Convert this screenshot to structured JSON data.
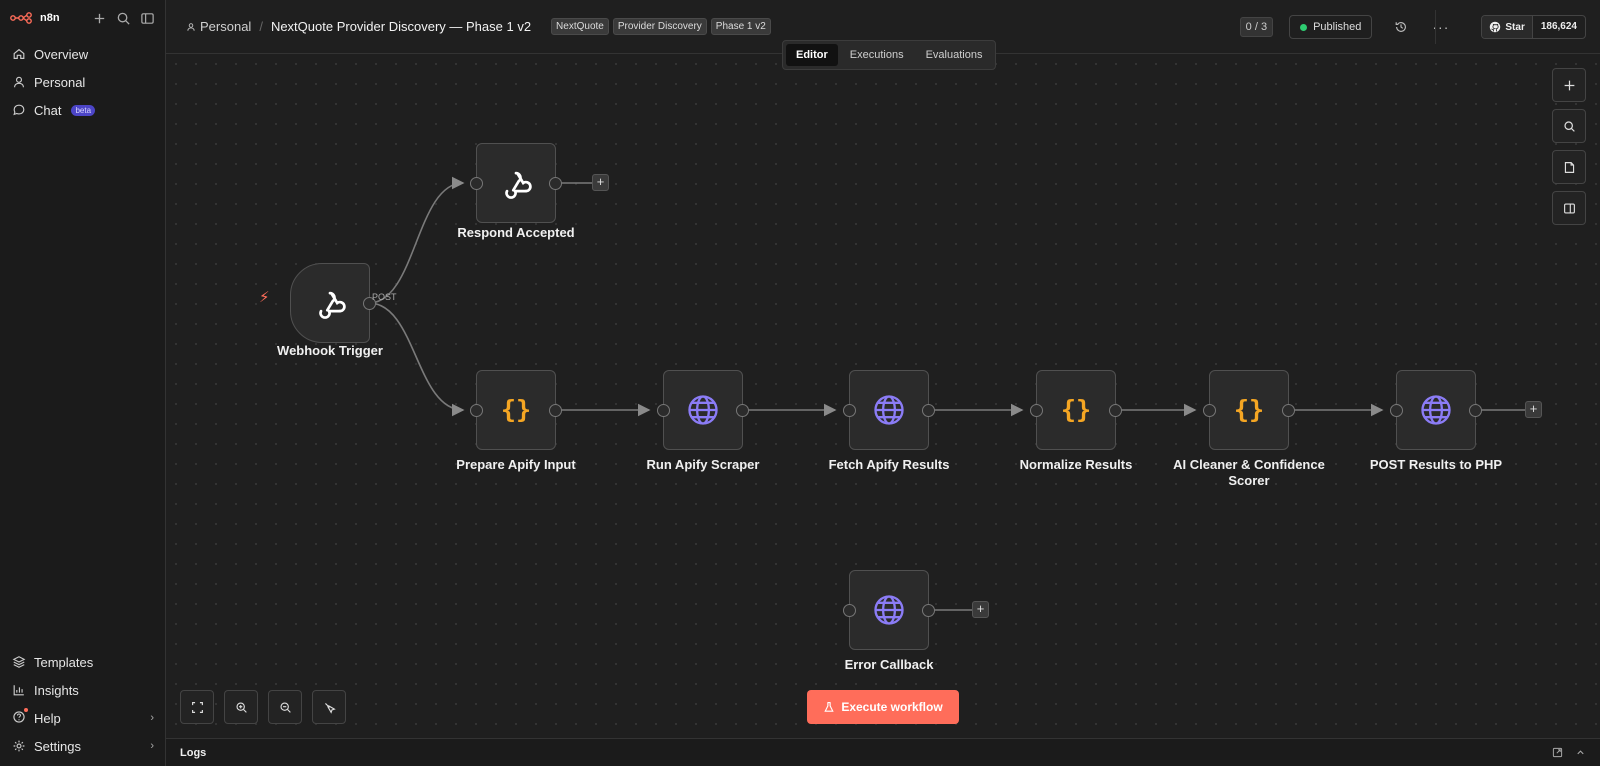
{
  "app": {
    "logo_text": "n8n"
  },
  "sidebar": {
    "items": [
      {
        "label": "Overview",
        "icon": "home-icon"
      },
      {
        "label": "Personal",
        "icon": "user-icon"
      },
      {
        "label": "Chat",
        "icon": "chat-icon",
        "badge": "beta"
      }
    ],
    "bottom_items": [
      {
        "label": "Templates",
        "icon": "templates-icon"
      },
      {
        "label": "Insights",
        "icon": "insights-icon"
      },
      {
        "label": "Help",
        "icon": "help-icon"
      },
      {
        "label": "Settings",
        "icon": "settings-icon"
      }
    ]
  },
  "header": {
    "breadcrumb_project": "Personal",
    "breadcrumb_sep": "/",
    "workflow_title": "NextQuote Provider Discovery — Phase 1 v2",
    "tags": [
      "NextQuote",
      "Provider Discovery",
      "Phase 1 v2"
    ],
    "counter": "0 / 3",
    "status": "Published",
    "status_color": "#2ecc71",
    "github_star_label": "Star",
    "github_star_count": "186,624"
  },
  "tabs": [
    {
      "label": "Editor",
      "active": true
    },
    {
      "label": "Executions",
      "active": false
    },
    {
      "label": "Evaluations",
      "active": false
    }
  ],
  "nodes": {
    "webhook_trigger": {
      "label": "Webhook Trigger",
      "icon": "webhook-icon",
      "output_label": "POST"
    },
    "respond_accepted": {
      "label": "Respond Accepted",
      "icon": "webhook-icon"
    },
    "prepare_apify_input": {
      "label": "Prepare Apify Input",
      "icon": "code-braces-icon"
    },
    "run_apify_scraper": {
      "label": "Run Apify Scraper",
      "icon": "globe-icon"
    },
    "fetch_apify_results": {
      "label": "Fetch Apify Results",
      "icon": "globe-icon"
    },
    "normalize_results": {
      "label": "Normalize Results",
      "icon": "code-braces-icon"
    },
    "ai_cleaner": {
      "label": "AI Cleaner & Confidence Scorer",
      "icon": "code-braces-icon"
    },
    "post_results": {
      "label": "POST Results to PHP",
      "icon": "globe-icon"
    },
    "error_callback": {
      "label": "Error Callback",
      "icon": "globe-icon"
    }
  },
  "canvas": {
    "execute_button": "Execute workflow",
    "accent_color": "#ff6d5a",
    "code_icon_color": "#f5a623",
    "globe_icon_color": "#8b7cf6"
  },
  "logs": {
    "label": "Logs"
  }
}
